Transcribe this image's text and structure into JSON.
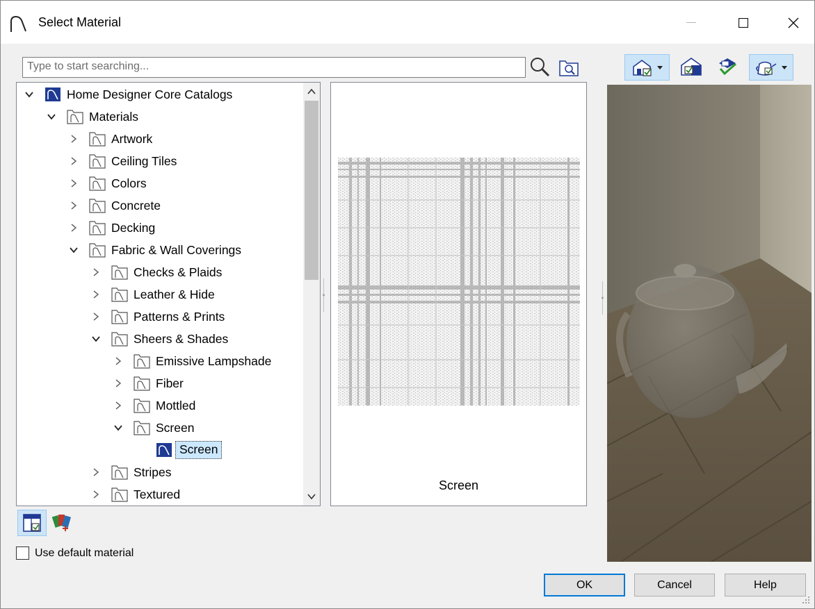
{
  "window": {
    "title": "Select Material"
  },
  "search": {
    "placeholder": "Type to start searching..."
  },
  "tree": {
    "items": [
      {
        "label": "Home Designer Core Catalogs",
        "level": 0,
        "expanded": true,
        "type": "catalog"
      },
      {
        "label": "Materials",
        "level": 1,
        "expanded": true,
        "type": "folder"
      },
      {
        "label": "Artwork",
        "level": 2,
        "expanded": false,
        "type": "folder"
      },
      {
        "label": "Ceiling Tiles",
        "level": 2,
        "expanded": false,
        "type": "folder"
      },
      {
        "label": "Colors",
        "level": 2,
        "expanded": false,
        "type": "folder"
      },
      {
        "label": "Concrete",
        "level": 2,
        "expanded": false,
        "type": "folder"
      },
      {
        "label": "Decking",
        "level": 2,
        "expanded": false,
        "type": "folder"
      },
      {
        "label": "Fabric & Wall Coverings",
        "level": 2,
        "expanded": true,
        "type": "folder"
      },
      {
        "label": "Checks & Plaids",
        "level": 3,
        "expanded": false,
        "type": "folder"
      },
      {
        "label": "Leather & Hide",
        "level": 3,
        "expanded": false,
        "type": "folder"
      },
      {
        "label": "Patterns & Prints",
        "level": 3,
        "expanded": false,
        "type": "folder"
      },
      {
        "label": "Sheers & Shades",
        "level": 3,
        "expanded": true,
        "type": "folder"
      },
      {
        "label": "Emissive Lampshade",
        "level": 4,
        "expanded": false,
        "type": "folder"
      },
      {
        "label": "Fiber",
        "level": 4,
        "expanded": false,
        "type": "folder"
      },
      {
        "label": "Mottled",
        "level": 4,
        "expanded": false,
        "type": "folder"
      },
      {
        "label": "Screen",
        "level": 4,
        "expanded": true,
        "type": "folder"
      },
      {
        "label": "Screen",
        "level": 5,
        "expanded": false,
        "type": "material",
        "selected": true
      },
      {
        "label": "Stripes",
        "level": 3,
        "expanded": false,
        "type": "folder"
      },
      {
        "label": "Textured",
        "level": 3,
        "expanded": false,
        "type": "folder"
      }
    ]
  },
  "preview": {
    "material_name": "Screen"
  },
  "options": {
    "use_default_label": "Use default material",
    "use_default_checked": false
  },
  "buttons": {
    "ok": "OK",
    "cancel": "Cancel",
    "help": "Help"
  },
  "colors": {
    "accent": "#0078d7",
    "selection": "#cce8ff",
    "catalog_icon": "#1f3a93"
  }
}
